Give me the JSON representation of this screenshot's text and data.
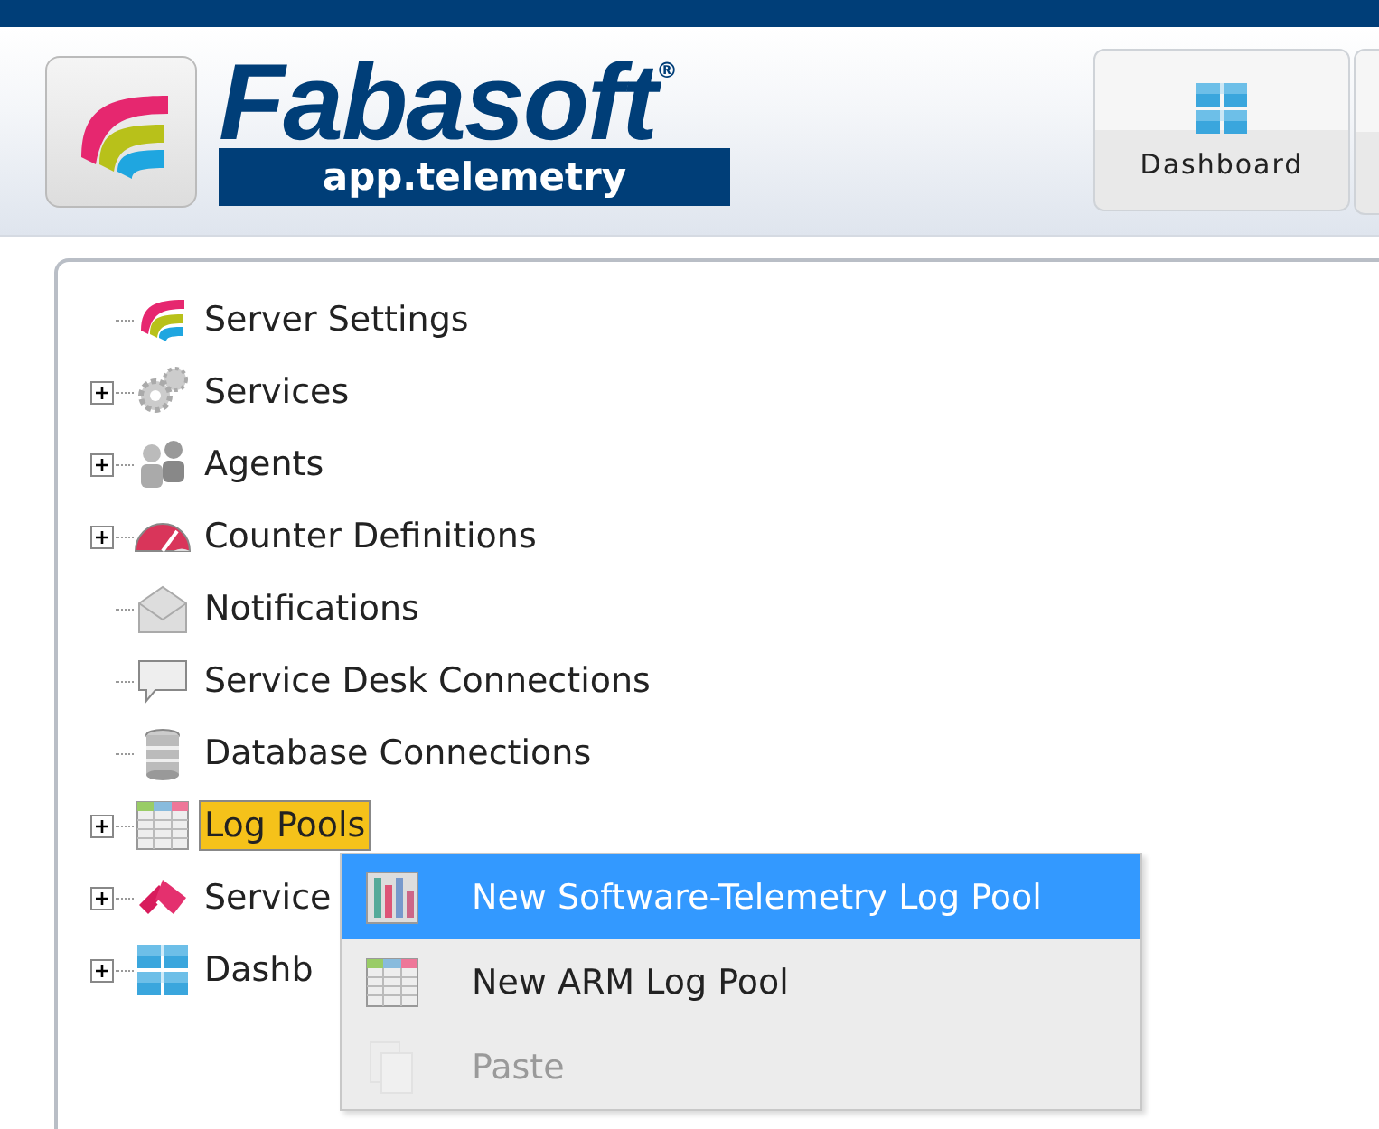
{
  "header": {
    "brand": "Fabasoft",
    "registered": "®",
    "product": "app.telemetry",
    "toolbar": [
      {
        "label": "Dashboard"
      }
    ]
  },
  "tree": {
    "items": [
      {
        "label": "Server Settings",
        "expandable": false,
        "selected": false
      },
      {
        "label": "Services",
        "expandable": true,
        "selected": false
      },
      {
        "label": "Agents",
        "expandable": true,
        "selected": false
      },
      {
        "label": "Counter Definitions",
        "expandable": true,
        "selected": false
      },
      {
        "label": "Notifications",
        "expandable": false,
        "selected": false
      },
      {
        "label": "Service Desk Connections",
        "expandable": false,
        "selected": false
      },
      {
        "label": "Database Connections",
        "expandable": false,
        "selected": false
      },
      {
        "label": "Log Pools",
        "expandable": true,
        "selected": true
      },
      {
        "label": "Service",
        "expandable": true,
        "selected": false
      },
      {
        "label": "Dashb",
        "expandable": true,
        "selected": false
      }
    ]
  },
  "context_menu": {
    "items": [
      {
        "label": "New Software-Telemetry Log Pool",
        "selected": true,
        "disabled": false
      },
      {
        "label": "New ARM Log Pool",
        "selected": false,
        "disabled": false
      },
      {
        "label": "Paste",
        "selected": false,
        "disabled": true
      }
    ]
  }
}
